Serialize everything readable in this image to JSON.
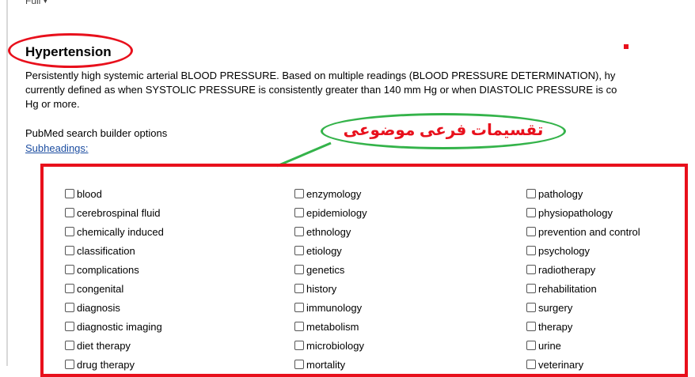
{
  "top_link": {
    "label": "Full",
    "icon": "caret-down-icon"
  },
  "term": {
    "title": "Hypertension",
    "definition_lines": [
      "Persistently high systemic arterial BLOOD PRESSURE. Based on multiple readings (BLOOD PRESSURE DETERMINATION), hy",
      "currently defined as when SYSTOLIC PRESSURE is consistently greater than 140 mm Hg or when DIASTOLIC PRESSURE is co",
      "Hg or more."
    ]
  },
  "search_builder": {
    "label": "PubMed search builder options",
    "subheadings_link": "Subheadings:"
  },
  "annotation": {
    "callout_text": "تقسیمات فرعی موضوعی",
    "colors": {
      "red": "#e8101c",
      "green": "#34b34a"
    }
  },
  "subheadings": {
    "columns": [
      [
        {
          "label": "blood",
          "checked": false
        },
        {
          "label": "cerebrospinal fluid",
          "checked": false
        },
        {
          "label": "chemically induced",
          "checked": false
        },
        {
          "label": "classification",
          "checked": false
        },
        {
          "label": "complications",
          "checked": false
        },
        {
          "label": "congenital",
          "checked": false
        },
        {
          "label": "diagnosis",
          "checked": false
        },
        {
          "label": "diagnostic imaging",
          "checked": false
        },
        {
          "label": "diet therapy",
          "checked": false
        },
        {
          "label": "drug therapy",
          "checked": false
        }
      ],
      [
        {
          "label": "enzymology",
          "checked": false
        },
        {
          "label": "epidemiology",
          "checked": false
        },
        {
          "label": "ethnology",
          "checked": false
        },
        {
          "label": "etiology",
          "checked": false
        },
        {
          "label": "genetics",
          "checked": false
        },
        {
          "label": "history",
          "checked": false
        },
        {
          "label": "immunology",
          "checked": false
        },
        {
          "label": "metabolism",
          "checked": false
        },
        {
          "label": "microbiology",
          "checked": false
        },
        {
          "label": "mortality",
          "checked": false
        }
      ],
      [
        {
          "label": "pathology",
          "checked": false
        },
        {
          "label": "physiopathology",
          "checked": false
        },
        {
          "label": "prevention and control",
          "checked": false
        },
        {
          "label": "psychology",
          "checked": false
        },
        {
          "label": "radiotherapy",
          "checked": false
        },
        {
          "label": "rehabilitation",
          "checked": false
        },
        {
          "label": "surgery",
          "checked": false
        },
        {
          "label": "therapy",
          "checked": false
        },
        {
          "label": "urine",
          "checked": false
        },
        {
          "label": "veterinary",
          "checked": false
        }
      ]
    ]
  }
}
